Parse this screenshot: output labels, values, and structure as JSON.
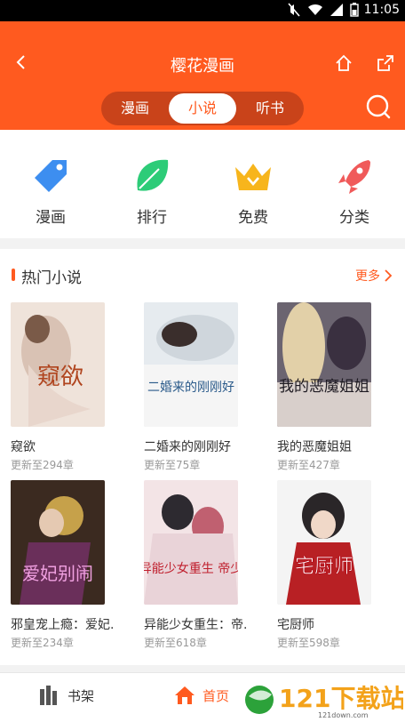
{
  "status_bar": {
    "time": "11:05"
  },
  "header": {
    "title": "樱花漫画",
    "tabs": [
      {
        "label": "漫画",
        "active": false
      },
      {
        "label": "小说",
        "active": true
      },
      {
        "label": "听书",
        "active": false
      }
    ]
  },
  "quick_nav": [
    {
      "label": "漫画",
      "icon": "tag-icon",
      "color": "#3d8ef0"
    },
    {
      "label": "排行",
      "icon": "leaf-icon",
      "color": "#2dcc78"
    },
    {
      "label": "免费",
      "icon": "crown-icon",
      "color": "#f7b51c"
    },
    {
      "label": "分类",
      "icon": "rocket-icon",
      "color": "#f05a5a"
    }
  ],
  "section": {
    "title": "热门小说",
    "more": "更多"
  },
  "books": [
    {
      "title": "窥欲",
      "subtitle": "更新至294章",
      "cover_text": "窥欲"
    },
    {
      "title": "二婚来的刚刚好",
      "subtitle": "更新至75章",
      "cover_text": "二婚来的刚刚好"
    },
    {
      "title": "我的恶魔姐姐",
      "subtitle": "更新至427章",
      "cover_text": "我的恶魔姐姐"
    },
    {
      "title": "邪皇宠上瘾：爱妃.",
      "subtitle": "更新至234章",
      "cover_text": "爱妃别闹"
    },
    {
      "title": "异能少女重生：帝.",
      "subtitle": "更新至618章",
      "cover_text": "异能少女重生 帝少"
    },
    {
      "title": "宅厨师",
      "subtitle": "更新至598章",
      "cover_text": "宅厨师"
    }
  ],
  "bottom_nav": {
    "shelf": "书架",
    "home": "首页"
  },
  "watermark": {
    "text": "121下载站",
    "sub": "121down.com"
  },
  "colors": {
    "accent": "#ff5a1f"
  }
}
